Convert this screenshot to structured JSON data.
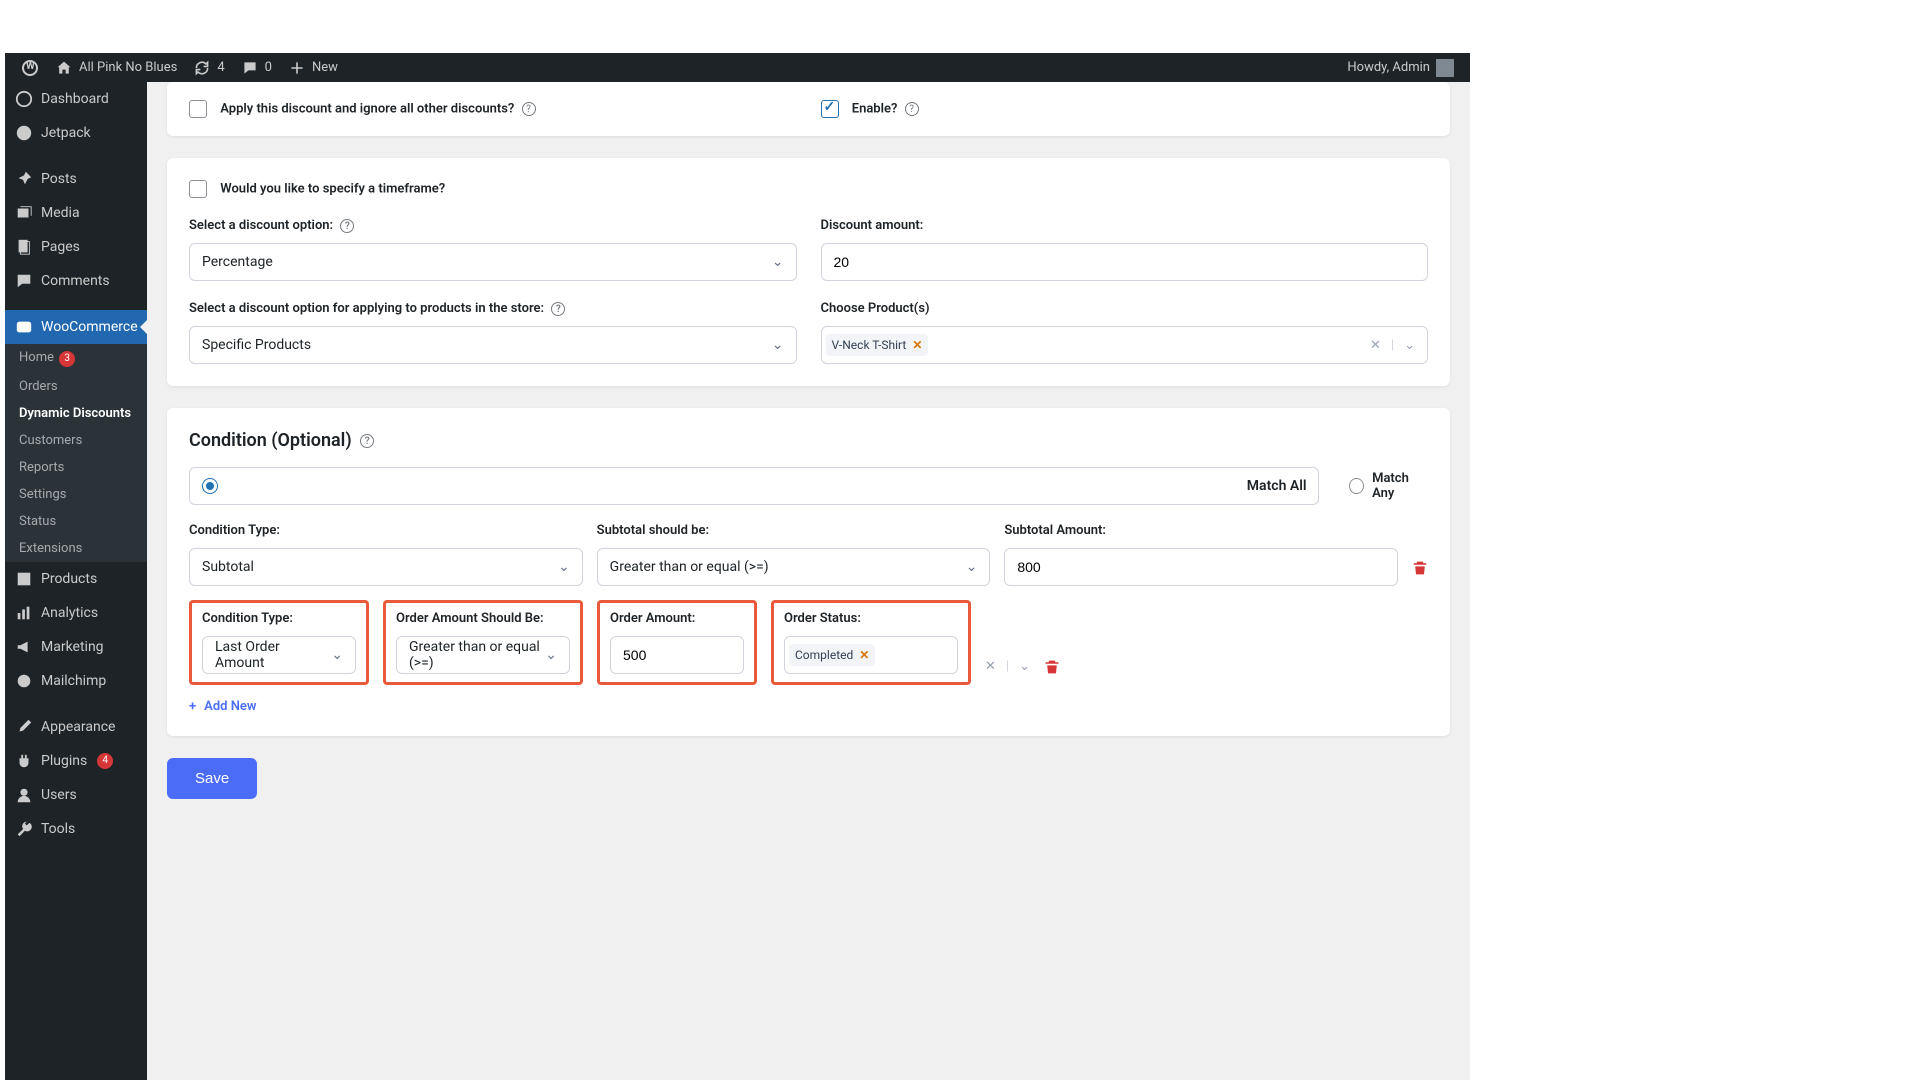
{
  "adminbar": {
    "site_name": "All Pink No Blues",
    "updates_count": "4",
    "comments_count": "0",
    "new_label": "New",
    "howdy": "Howdy, Admin"
  },
  "sidebar": {
    "dashboard": "Dashboard",
    "jetpack": "Jetpack",
    "posts": "Posts",
    "media": "Media",
    "pages": "Pages",
    "comments": "Comments",
    "woocommerce": "WooCommerce",
    "woo_sub": {
      "home": "Home",
      "home_badge": "3",
      "orders": "Orders",
      "dynamic_discounts": "Dynamic Discounts",
      "customers": "Customers",
      "reports": "Reports",
      "settings": "Settings",
      "status": "Status",
      "extensions": "Extensions"
    },
    "products": "Products",
    "analytics": "Analytics",
    "marketing": "Marketing",
    "mailchimp": "Mailchimp",
    "appearance": "Appearance",
    "plugins": "Plugins",
    "plugins_badge": "4",
    "users": "Users",
    "tools": "Tools"
  },
  "form": {
    "apply_ignore_label": "Apply this discount and ignore all other discounts?",
    "enable_label": "Enable?",
    "timeframe_label": "Would you like to specify a timeframe?",
    "discount_option_label": "Select a discount option:",
    "discount_option_value": "Percentage",
    "discount_amount_label": "Discount amount:",
    "discount_amount_value": "20",
    "apply_products_label": "Select a discount option for applying to products in the store:",
    "apply_products_value": "Specific Products",
    "choose_products_label": "Choose Product(s)",
    "product_tag": "V-Neck T-Shirt",
    "condition_title": "Condition (Optional)",
    "match_all": "Match All",
    "match_any": "Match Any",
    "row1": {
      "type_label": "Condition Type:",
      "type_value": "Subtotal",
      "should_label": "Subtotal should be:",
      "should_value": "Greater than or equal (>=)",
      "amount_label": "Subtotal Amount:",
      "amount_value": "800"
    },
    "row2": {
      "type_label": "Condition Type:",
      "type_value": "Last Order Amount",
      "should_label": "Order Amount Should Be:",
      "should_value": "Greater than or equal (>=)",
      "amount_label": "Order Amount:",
      "amount_value": "500",
      "status_label": "Order Status:",
      "status_tag": "Completed"
    },
    "add_new": "Add New",
    "save": "Save"
  }
}
